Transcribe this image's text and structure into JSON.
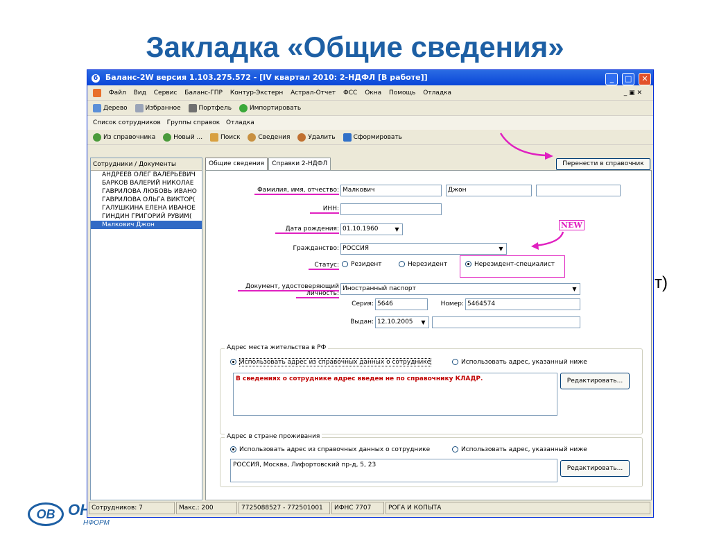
{
  "slide": {
    "title": "Закладка «Общие сведения»",
    "background_fragment": "т)",
    "logo_text": "ОВ",
    "logo_text2": "ОН",
    "logo_sub": "НФОРМ"
  },
  "window": {
    "title": "Баланс-2W  версия 1.103.275.572 - [IV квартал 2010: 2-НДФЛ [В работе]]",
    "app_icon": "б",
    "menu": [
      "Файл",
      "Вид",
      "Сервис",
      "Баланс-ГПР",
      "Контур-Экстерн",
      "Астрал-Отчет",
      "ФСС",
      "Окна",
      "Помощь",
      "Отладка"
    ],
    "main_toolbar": [
      "Дерево",
      "Избранное",
      "Портфель",
      "Импортировать"
    ],
    "section_menu": [
      "Список сотрудников",
      "Группы справок",
      "Отладка"
    ],
    "section_toolbar": [
      "Из справочника",
      "Новый ...",
      "Поиск",
      "Сведения",
      "Удалить",
      "Сформировать"
    ]
  },
  "left_panel": {
    "header": "Сотрудники / Документы",
    "employees": [
      "АНДРЕЕВ ОЛЕГ ВАЛЕРЬЕВИЧ",
      "БАРКОВ ВАЛЕРИЙ НИКОЛАЕ",
      "ГАВРИЛОВА ЛЮБОВЬ ИВАНО",
      "ГАВРИЛОВА ОЛЬГА ВИКТОР(",
      "ГАЛУШКИНА ЕЛЕНА ИВАНОЕ",
      "ГИНДИН ГРИГОРИЙ РУВИМ(",
      "Малкович Джон"
    ],
    "selected": "Малкович Джон"
  },
  "tabs": {
    "general": "Общие сведения",
    "certificates": "Справки 2-НДФЛ",
    "transfer_button": "Перенести в справочник"
  },
  "form": {
    "fio_label": "Фамилия, имя, отчество:",
    "last_name": "Малкович",
    "first_name": "Джон",
    "middle_name": "",
    "inn_label": "ИНН:",
    "inn_value": "",
    "birth_label": "Дата рождения:",
    "birth_value": "01.10.1960",
    "citizenship_label": "Гражданство:",
    "citizenship_value": "РОССИЯ",
    "status_label": "Статус:",
    "status_options": [
      "Резидент",
      "Нерезидент",
      "Нерезидент-специалист"
    ],
    "status_selected": "Нерезидент-специалист",
    "doc_label_1": "Документ, удостоверяющий",
    "doc_label_2": "личность:",
    "doc_value": "Иностранный паспорт",
    "series_label": "Серия:",
    "series_value": "5646",
    "number_label": "Номер:",
    "number_value": "5464574",
    "issued_label": "Выдан:",
    "issued_value": "12.10.2005",
    "issued_by": "",
    "new_badge": "NEW"
  },
  "address_rf": {
    "title": "Адрес места жительства в РФ",
    "option_ref": "Использовать адрес из справочных данных о сотруднике",
    "option_below": "Использовать адрес, указанный ниже",
    "selected": "Использовать адрес из справочных данных о сотруднике",
    "warning": "В сведениях о сотруднике адрес введен не по справочнику КЛАДР.",
    "edit_button": "Редактировать..."
  },
  "address_home": {
    "title": "Адрес в стране проживания",
    "option_ref": "Использовать адрес из справочных данных о сотруднике",
    "option_below": "Использовать адрес, указанный ниже",
    "selected": "Использовать адрес из справочных данных о сотруднике",
    "address": "РОССИЯ, Москва, Лифортовский пр-д, 5, 23",
    "edit_button": "Редактировать..."
  },
  "statusbar": {
    "employees": "Сотрудников: 7",
    "max": "Макс.: 200",
    "inn_kpp": "7725088527 - 772501001",
    "ifns": "ИФНС 7707",
    "org": "РОГА И КОПЫТА"
  },
  "colors": {
    "title_blue": "#1d5fa4",
    "annotation_pink": "#e020c0",
    "selection": "#316ac5",
    "warning_red": "#c00000"
  }
}
